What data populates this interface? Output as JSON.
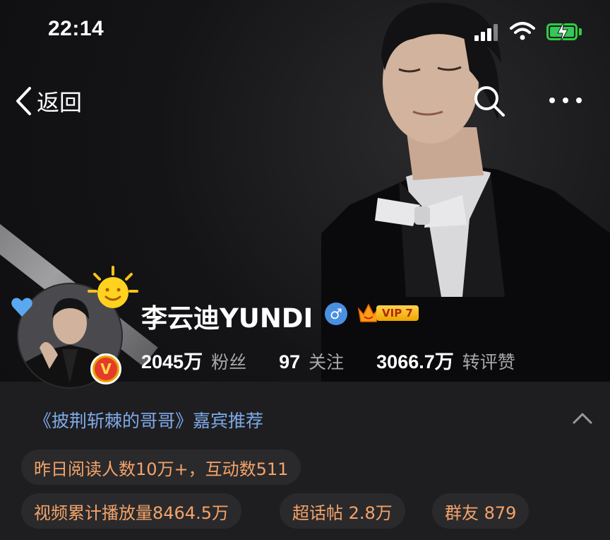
{
  "status_bar": {
    "time": "22:14"
  },
  "nav": {
    "back_label": "返回"
  },
  "profile": {
    "name": "李云迪YUNDI",
    "gender_symbol": "♂",
    "vip_label": "VIP 7",
    "verified_badge": "V",
    "stats": [
      {
        "value": "2045万",
        "label": "粉丝"
      },
      {
        "value": "97",
        "label": "关注"
      },
      {
        "value": "3066.7万",
        "label": "转评赞"
      }
    ]
  },
  "promo": {
    "text": "《披荆斩棘的哥哥》嘉宾推荐"
  },
  "info_pills": {
    "yesterday": "昨日阅读人数10万+，互动数511",
    "video": "视频累计播放量8464.5万",
    "supertopic": "超话帖 2.8万",
    "group": "群友 879"
  },
  "colors": {
    "accent_orange": "#f4a36a",
    "link_blue": "#7fa9e8",
    "battery_green": "#34c759"
  }
}
